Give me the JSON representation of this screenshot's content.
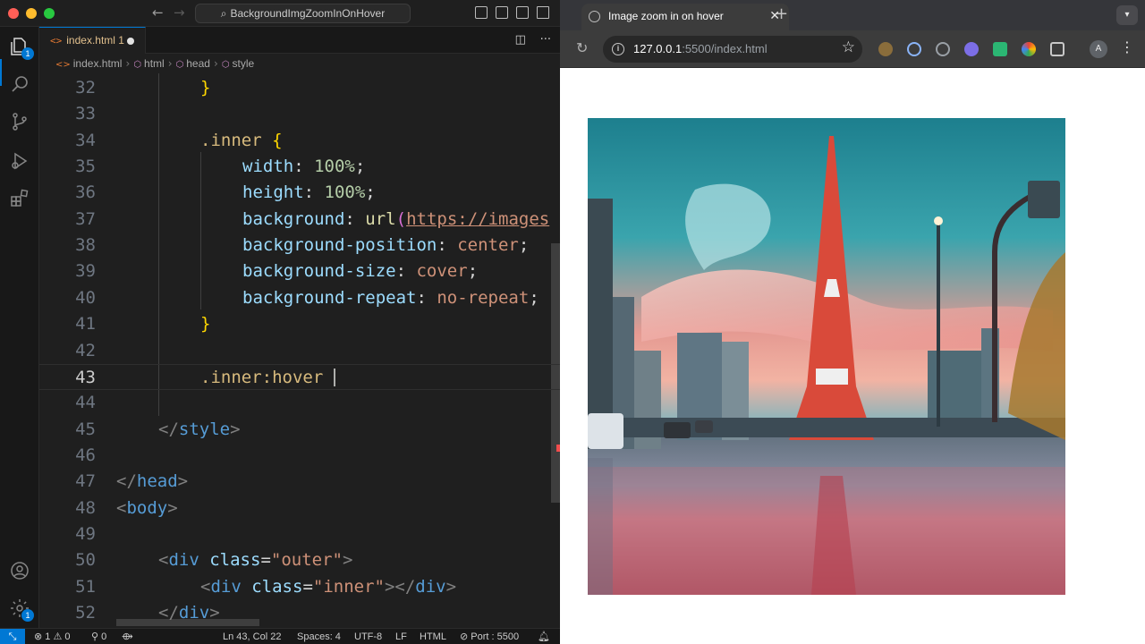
{
  "vscode": {
    "title_search": "BackgroundImgZoomInOnHover",
    "tab": {
      "label": "index.html",
      "problems": "1"
    },
    "breadcrumbs": [
      "index.html",
      "html",
      "head",
      "style"
    ],
    "explorer_badge": "1",
    "accounts_badge": "1",
    "code_lines": [
      {
        "n": "32",
        "indent": 2,
        "tokens": [
          [
            "}",
            "t-brace"
          ]
        ]
      },
      {
        "n": "33",
        "indent": 0,
        "tokens": []
      },
      {
        "n": "34",
        "indent": 2,
        "tokens": [
          [
            ".inner",
            "t-sel"
          ],
          [
            " ",
            ""
          ],
          [
            "{",
            "t-brace"
          ]
        ]
      },
      {
        "n": "35",
        "indent": 3,
        "tokens": [
          [
            "width",
            "t-prop"
          ],
          [
            ": ",
            ""
          ],
          [
            "100%",
            "t-num"
          ],
          [
            ";",
            ""
          ]
        ]
      },
      {
        "n": "36",
        "indent": 3,
        "tokens": [
          [
            "height",
            "t-prop"
          ],
          [
            ": ",
            ""
          ],
          [
            "100%",
            "t-num"
          ],
          [
            ";",
            ""
          ]
        ]
      },
      {
        "n": "37",
        "indent": 3,
        "tokens": [
          [
            "background",
            "t-prop"
          ],
          [
            ": ",
            ""
          ],
          [
            "url",
            "t-fn"
          ],
          [
            "(",
            "t-brace2"
          ],
          [
            "https://images",
            "t-url"
          ]
        ]
      },
      {
        "n": "38",
        "indent": 3,
        "tokens": [
          [
            "background-position",
            "t-prop"
          ],
          [
            ": ",
            ""
          ],
          [
            "center",
            "t-val"
          ],
          [
            ";",
            ""
          ]
        ]
      },
      {
        "n": "39",
        "indent": 3,
        "tokens": [
          [
            "background-size",
            "t-prop"
          ],
          [
            ": ",
            ""
          ],
          [
            "cover",
            "t-val"
          ],
          [
            ";",
            ""
          ]
        ]
      },
      {
        "n": "40",
        "indent": 3,
        "tokens": [
          [
            "background-repeat",
            "t-prop"
          ],
          [
            ": ",
            ""
          ],
          [
            "no-repeat",
            "t-val"
          ],
          [
            ";",
            ""
          ]
        ]
      },
      {
        "n": "41",
        "indent": 2,
        "tokens": [
          [
            "}",
            "t-brace"
          ]
        ]
      },
      {
        "n": "42",
        "indent": 0,
        "tokens": []
      },
      {
        "n": "43",
        "indent": 2,
        "tokens": [
          [
            ".inner:hover ",
            "t-sel"
          ]
        ],
        "current": true
      },
      {
        "n": "44",
        "indent": 0,
        "tokens": []
      },
      {
        "n": "45",
        "indent": 1,
        "tokens": [
          [
            "</",
            "t-punc"
          ],
          [
            "style",
            "t-tag"
          ],
          [
            ">",
            "t-punc"
          ]
        ]
      },
      {
        "n": "46",
        "indent": 0,
        "tokens": []
      },
      {
        "n": "47",
        "indent": 0,
        "tokens": [
          [
            "</",
            "t-punc"
          ],
          [
            "head",
            "t-tag"
          ],
          [
            ">",
            "t-punc"
          ]
        ]
      },
      {
        "n": "48",
        "indent": 0,
        "tokens": [
          [
            "<",
            "t-punc"
          ],
          [
            "body",
            "t-tag"
          ],
          [
            ">",
            "t-punc"
          ]
        ]
      },
      {
        "n": "49",
        "indent": 0,
        "tokens": []
      },
      {
        "n": "50",
        "indent": 1,
        "tokens": [
          [
            "<",
            "t-punc"
          ],
          [
            "div",
            "t-tag"
          ],
          [
            " ",
            ""
          ],
          [
            "class",
            "t-attr"
          ],
          [
            "=",
            ""
          ],
          [
            "\"outer\"",
            "t-str"
          ],
          [
            ">",
            "t-punc"
          ]
        ]
      },
      {
        "n": "51",
        "indent": 2,
        "tokens": [
          [
            "<",
            "t-punc"
          ],
          [
            "div",
            "t-tag"
          ],
          [
            " ",
            ""
          ],
          [
            "class",
            "t-attr"
          ],
          [
            "=",
            ""
          ],
          [
            "\"inner\"",
            "t-str"
          ],
          [
            "></",
            "t-punc"
          ],
          [
            "div",
            "t-tag"
          ],
          [
            ">",
            "t-punc"
          ]
        ]
      },
      {
        "n": "52",
        "indent": 1,
        "tokens": [
          [
            "</",
            "t-punc"
          ],
          [
            "div",
            "t-tag"
          ],
          [
            ">",
            "t-punc"
          ]
        ]
      }
    ],
    "status": {
      "errors": "1",
      "warnings": "0",
      "info": "0",
      "position": "Ln 43, Col 22",
      "spaces": "Spaces: 4",
      "encoding": "UTF-8",
      "eol": "LF",
      "language": "HTML",
      "port": "Port : 5500"
    }
  },
  "browser": {
    "tab_title": "Image zoom in on hover",
    "url_host": "127.0.0.1",
    "url_rest": ":5500/index.html",
    "profile_initial": "A"
  },
  "colors": {
    "vscode_accent": "#0078d4",
    "html_icon": "#e37933",
    "modified_tab_text": "#e2c08d"
  }
}
